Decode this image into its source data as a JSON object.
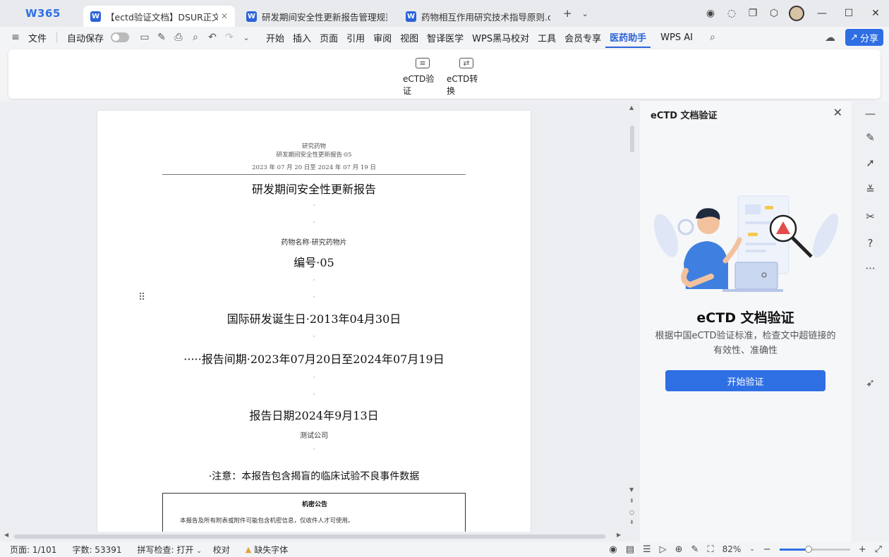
{
  "app": {
    "logo": "W365",
    "tabs": [
      {
        "label": "【ectd验证文档】DSUR正文.doc",
        "icon": "W",
        "active": true,
        "close": "✕"
      },
      {
        "label": "研发期间安全性更新报告管理规范（",
        "icon": "W",
        "active": false
      },
      {
        "label": "药物相互作用研究技术指导原则.docx",
        "icon": "W",
        "active": false
      }
    ],
    "new_tab": "+",
    "tab_list": "⌄"
  },
  "menubar": {
    "file": "文件",
    "autosave": "自动保存",
    "items": [
      "开始",
      "插入",
      "页面",
      "引用",
      "审阅",
      "视图",
      "智译医学",
      "WPS黑马校对",
      "工具",
      "会员专享",
      "医药助手",
      "WPS AI"
    ],
    "active_item": "医药助手",
    "share": "分享"
  },
  "ribbon": {
    "validate": "eCTD验证",
    "convert": "eCTD转换"
  },
  "document": {
    "header_line1": "研究药物",
    "header_line2": "研发期间安全性更新报告·05",
    "header_line3": "2023 年 07 月 20 日至 2024 年 07 月 19 日",
    "title": "研发期间安全性更新报告",
    "drug_name": "药物名称·研究药物片",
    "number": "编号·05",
    "birth_date": "国际研发诞生日·2013年04月30日",
    "period": "·····报告间期·2023年07月20日至2024年07月19日",
    "report_date": "报告日期2024年9月13日",
    "company": "测试公司",
    "notice": "·注意：本报告包含揭盲的临床试验不良事件数据",
    "conf_title": "机密公告",
    "conf_body": "本报告及所有附表或附件可能包含机密信息，仅收件人才可使用。"
  },
  "panel": {
    "title": "eCTD 文档验证",
    "heading": "eCTD 文档验证",
    "description": "根据中国eCTD验证标准，检查文中超链接的有效性、准确性",
    "start_button": "开始验证"
  },
  "status": {
    "page": "页面: 1/101",
    "words": "字数: 53391",
    "spell": "拼写检查: 打开",
    "proof": "校对",
    "missing_font": "缺失字体",
    "zoom": "82%",
    "zoom_level": 0.41
  },
  "colors": {
    "accent": "#2f6fe4",
    "warning": "#e6a23c"
  }
}
